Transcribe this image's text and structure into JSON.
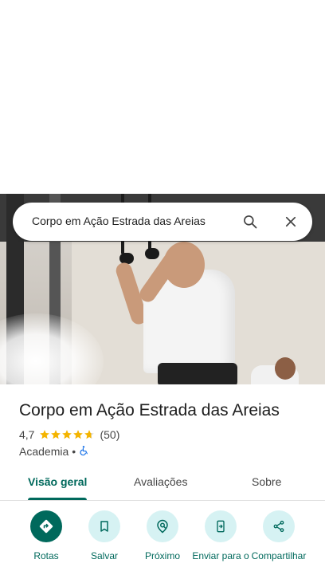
{
  "search": {
    "query": "Corpo em Ação Estrada das Areias",
    "search_icon": "search-icon",
    "close_icon": "close-icon"
  },
  "place": {
    "name": "Corpo em Ação Estrada das Areias",
    "rating": "4,7",
    "rating_value": 4.7,
    "review_count": "(50)",
    "category": "Academia",
    "separator": "•",
    "accessibility_icon": "wheelchair-icon"
  },
  "tabs": [
    {
      "label": "Visão geral",
      "active": true
    },
    {
      "label": "Avaliações",
      "active": false
    },
    {
      "label": "Sobre",
      "active": false
    }
  ],
  "actions": [
    {
      "label": "Rotas",
      "icon": "directions-icon"
    },
    {
      "label": "Salvar",
      "icon": "bookmark-icon"
    },
    {
      "label": "Próximo",
      "icon": "nearby-icon"
    },
    {
      "label": "Enviar para o",
      "icon": "send-to-phone-icon"
    },
    {
      "label": "Compartilhar",
      "icon": "share-icon"
    }
  ],
  "colors": {
    "accent": "#00695c",
    "action_bg": "#d6f2f3",
    "star": "#f4b400",
    "text": "#1f1f1f",
    "secondary_text": "#474747"
  }
}
